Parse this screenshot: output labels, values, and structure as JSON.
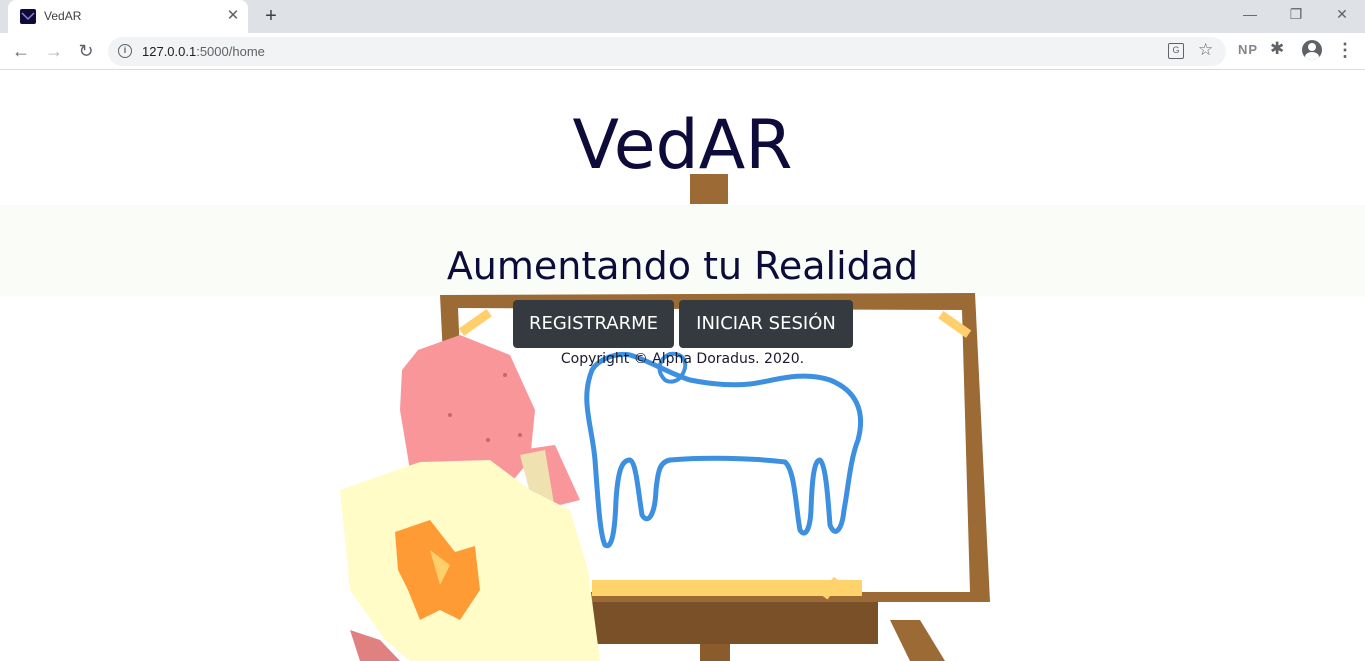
{
  "browser": {
    "tab_title": "VedAR",
    "url_host": "127.0.0.1",
    "url_rest": ":5000/home",
    "extension_label": "NP"
  },
  "page": {
    "title": "VedAR",
    "tagline": "Aumentando tu Realidad",
    "register_label": "REGISTRARME",
    "login_label": "INICIAR SESIÓN",
    "copyright": "Copyright © Alpha Doradus. 2020."
  },
  "colors": {
    "brand_navy": "#0d0b3a",
    "button_dark": "#343a40",
    "easel_wood": "#9c6a35",
    "drawing_blue": "#3d8fe0"
  }
}
